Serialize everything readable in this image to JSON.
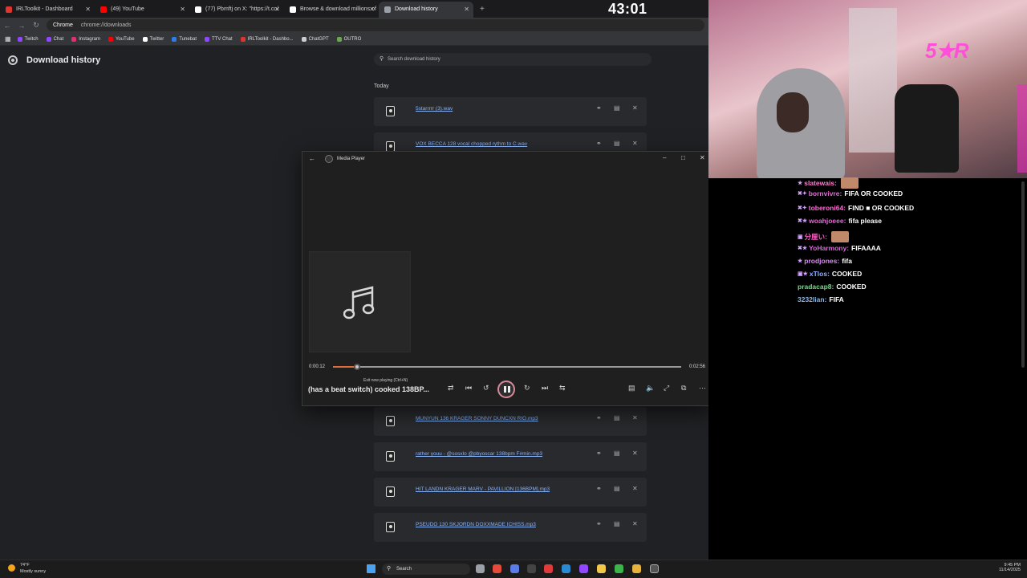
{
  "browser": {
    "tabs": [
      {
        "label": "IRLToolkit - Dashboard",
        "color": "#e0342f"
      },
      {
        "label": "(49) YouTube",
        "color": "#ff0000"
      },
      {
        "label": "(77) Pbmftj on X: \"https://t.co/",
        "color": "#ffffff"
      },
      {
        "label": "Browse & download millions of",
        "color": "#ffffff"
      },
      {
        "label": "Download history",
        "color": "#9aa0a6"
      }
    ],
    "new_tab": "+",
    "timer": "43:01",
    "omnibox": {
      "chip": "Chrome",
      "url": "chrome://downloads"
    },
    "bookmarks": [
      {
        "label": "Twitch",
        "color": "#9146ff"
      },
      {
        "label": "Chat",
        "color": "#9146ff"
      },
      {
        "label": "Instagram",
        "color": "#e1306c"
      },
      {
        "label": "YouTube",
        "color": "#ff0000"
      },
      {
        "label": "Twitter",
        "color": "#ffffff"
      },
      {
        "label": "Tunebat",
        "color": "#2b7de9"
      },
      {
        "label": "TTV Chat",
        "color": "#9146ff"
      },
      {
        "label": "IRLToolkit - Dashbo...",
        "color": "#e0342f"
      },
      {
        "label": "ChatGPT",
        "color": "#cccccc"
      },
      {
        "label": "OUTRO",
        "color": "#6aa84f"
      }
    ]
  },
  "downloads": {
    "title": "Download history",
    "search_placeholder": "Search download history",
    "section": "Today",
    "items": [
      "5starrrrr (3).wav",
      "VOX BECCA 128 vocal chopped rythm to C.wav",
      "MUNYUN 136 KRAGER SONNY DUNCXN RIO.mp3",
      "rather youu - @sosxlo @pbyoscar 138bpm F#min.mp3",
      "HIT LANDN KRAGER MARV - PAVILLION [136BPM].mp3",
      "PSEUDO 130 SKJORDN DOXXMADE ICHISS.mp3"
    ]
  },
  "media_player": {
    "title": "Media Player",
    "current_time": "0:00:12",
    "total_time": "0:02:56",
    "progress": 0.068,
    "tooltip": "Exit now playing (Ctrl+N)",
    "song": "(has a beat switch) cooked 138BP..."
  },
  "chat": {
    "messages": [
      {
        "user": "slatewais:",
        "color": "#ff7bd0",
        "text": "",
        "badges": "★",
        "emote": true
      },
      {
        "user": "bornvivre:",
        "color": "#e66bd8",
        "text": "FIFA OR COOKED",
        "badges": "✖✦"
      },
      {
        "user": "toberoni64:",
        "color": "#ff6bd3",
        "text": "FIND ■ OR COOKED",
        "badges": "✖✦"
      },
      {
        "user": "woahjoeee:",
        "color": "#e46bd6",
        "text": "fifa please",
        "badges": "✖★"
      },
      {
        "user": "分厘い:",
        "color": "#ff5ac8",
        "text": "",
        "badges": "▣",
        "emote": true
      },
      {
        "user": "YoHarmony:",
        "color": "#d86bd8",
        "text": "FIFAAAA",
        "badges": "✖★"
      },
      {
        "user": "prodjones:",
        "color": "#d88bf0",
        "text": "fifa",
        "badges": "★"
      },
      {
        "user": "xTlos:",
        "color": "#8fb3ff",
        "text": "COOKED",
        "badges": "▣★"
      },
      {
        "user": "pradacap8:",
        "color": "#7ad68a",
        "text": "COOKED",
        "badges": ""
      },
      {
        "user": "3232lian:",
        "color": "#8ab7e8",
        "text": "FIFA",
        "badges": ""
      }
    ]
  },
  "taskbar": {
    "weather_temp": "74°F",
    "weather_cond": "Mostly sunny",
    "search": "Search",
    "time": "9:45 PM",
    "date": "11/14/2025"
  }
}
